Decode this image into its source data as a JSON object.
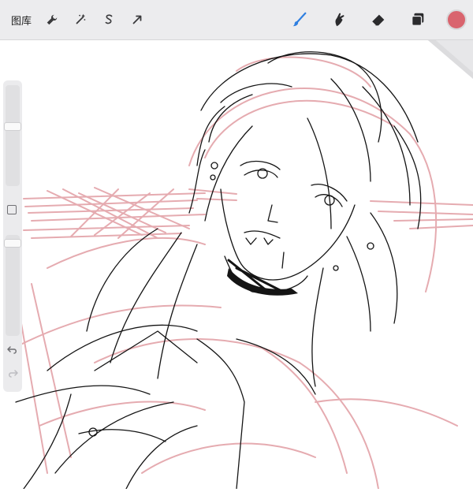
{
  "toolbar": {
    "gallery_label": "图库",
    "left_tools": [
      "wrench-icon",
      "magic-wand-icon",
      "selection-s-icon",
      "transform-arrow-icon"
    ],
    "right_tools": [
      "brush-icon",
      "smudge-icon",
      "eraser-icon",
      "layers-icon"
    ],
    "current_color": "#d9646e",
    "active_tool": "brush"
  },
  "sidebar": {
    "brush_size_level": 0.4,
    "opacity_level": 0.04
  },
  "colors": {
    "sketch_red": "#e3a2a8",
    "ink": "#141414",
    "accent_blue": "#2f7fe0"
  }
}
